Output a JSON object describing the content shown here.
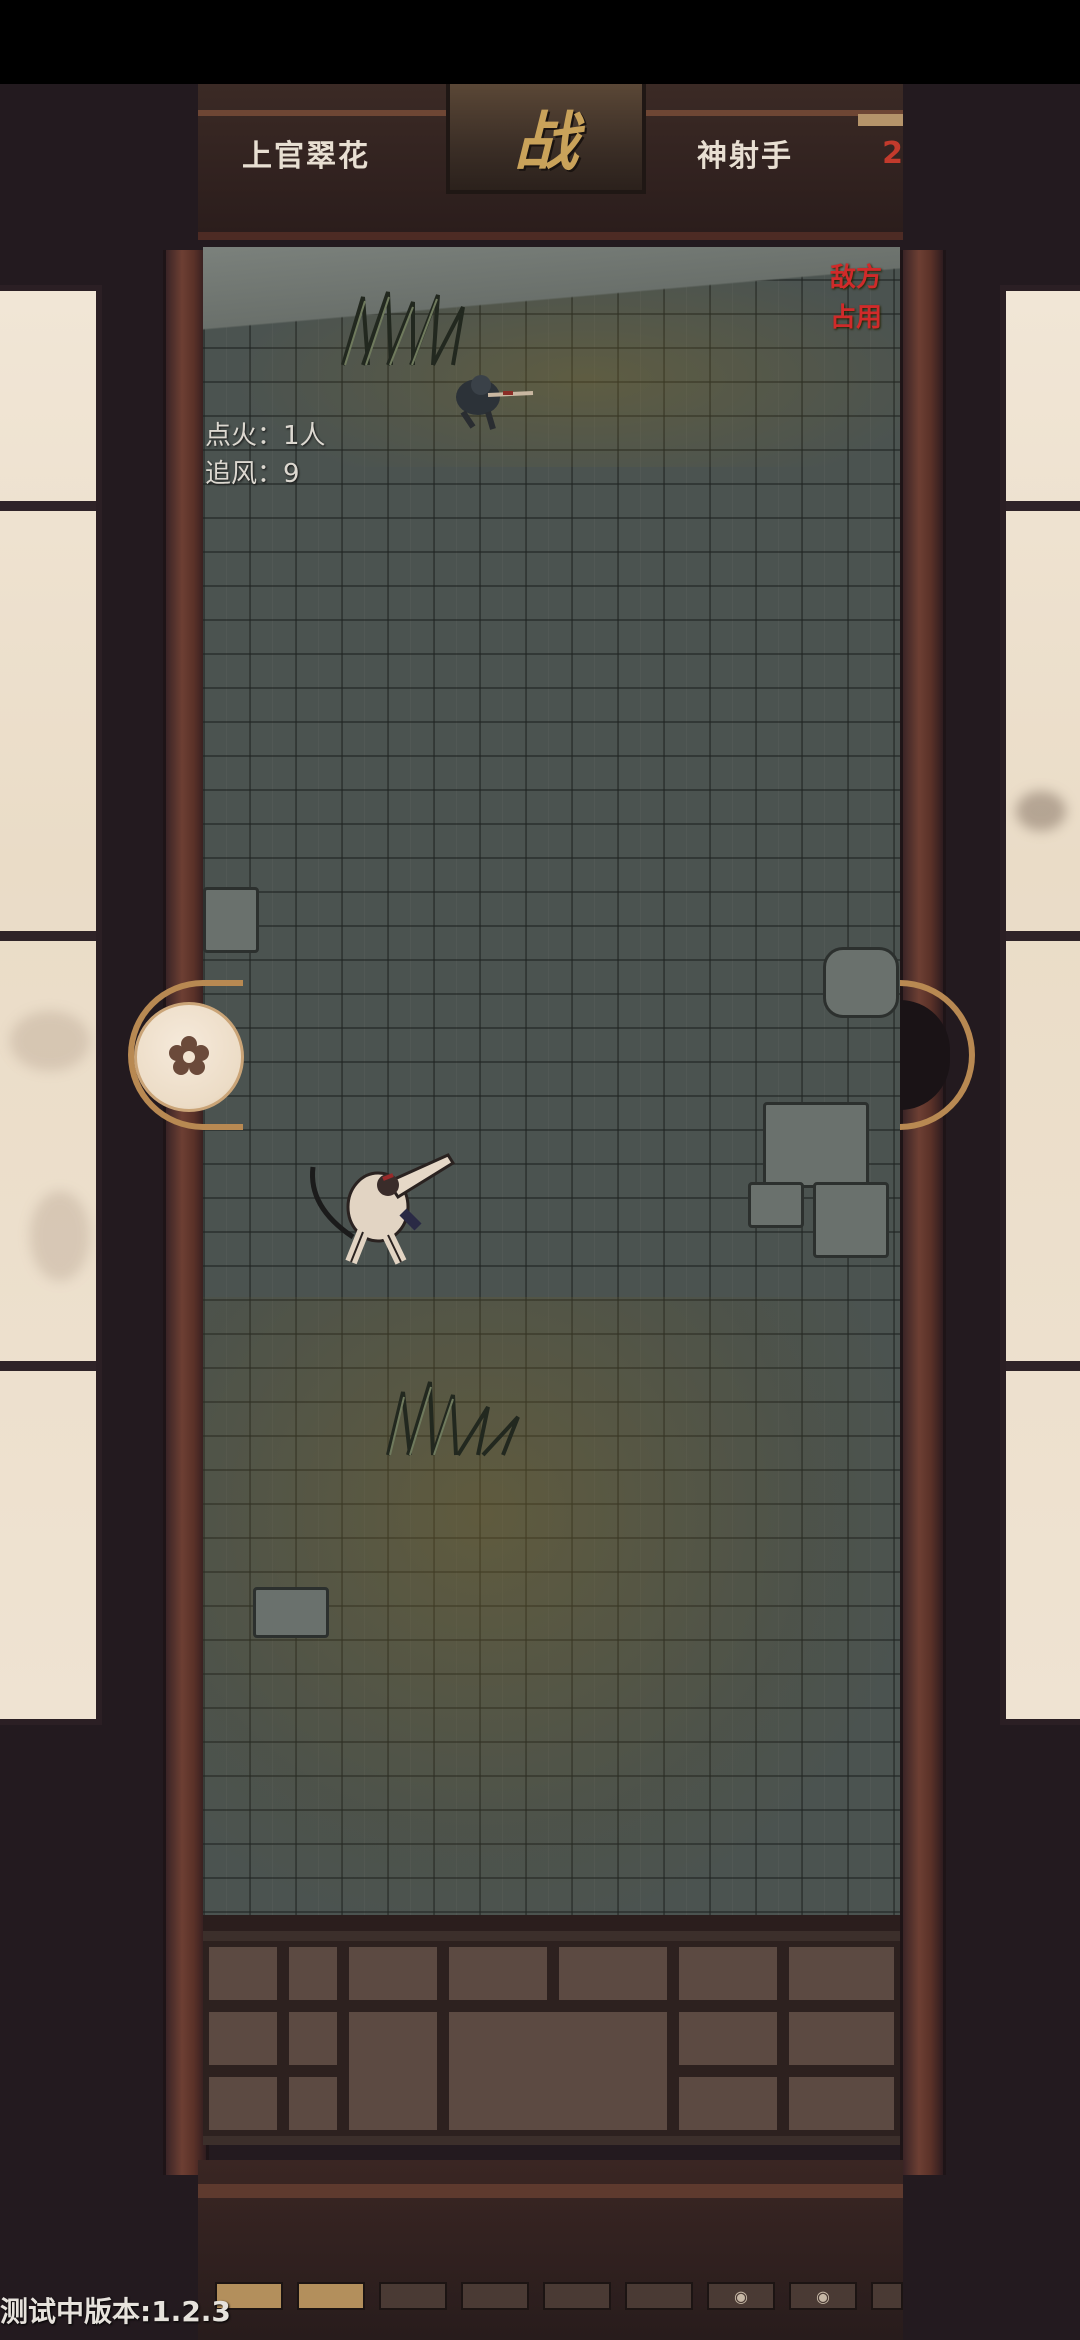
{
  "header": {
    "left_player_name": "上官翠花",
    "battle_glyph": "战",
    "right_player_name": "神射手",
    "right_badge_glyph": "2"
  },
  "hud": {
    "ignite_label": "点火：1人",
    "chase_wind_label": "追风：9",
    "enemy_alert_line1": "敌方",
    "enemy_alert_line2": "占用"
  },
  "settings": {
    "icon": "gear-icon"
  },
  "progress": {
    "filled_slots": 2,
    "empty_slots": 4,
    "locked_slots": 3,
    "lock_icon": "lock-icon"
  },
  "footer": {
    "version_text": "测试中版本:1.2.3"
  },
  "colors": {
    "accent_gold": "#b88952",
    "alert_red": "#d02a2a",
    "field_stone": "#4b5350"
  }
}
